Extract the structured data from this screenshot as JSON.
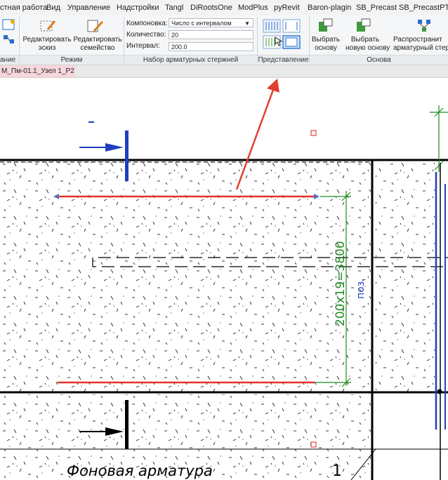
{
  "menu": [
    "стная работа",
    "Вид",
    "Управление",
    "Надстройки",
    "Tangl",
    "DiRootsOne",
    "ModPlus",
    "pyRevit",
    "Baron-plagin",
    "SB_Precast",
    "SB_PrecastPTM"
  ],
  "ribbon": {
    "left_cut_label": "ание",
    "edit_sketch": [
      "Редактировать",
      "эскиз"
    ],
    "edit_family": [
      "Редактировать",
      "семейство"
    ],
    "mode_panel": "Режим",
    "layout_label": "Компоновка:",
    "layout_value": "Число с интервалом",
    "quantity_label": "Количество:",
    "quantity_value": "20",
    "spacing_label": "Интервал:",
    "spacing_value": "200.0",
    "rebar_set_panel": "Набор арматурных стержней",
    "view_panel": "Представление",
    "select_base": [
      "Выбрать",
      "основу"
    ],
    "select_new_base": [
      "Выбрать",
      "новую основу"
    ],
    "distribute": [
      "Распространит",
      "арматурный стерж"
    ],
    "base_panel": "Основа"
  },
  "doc_tab": "М_Пм-01.1_Узел 1_Р2",
  "drawing": {
    "dim_text": "200x19=3800",
    "poz_text": "поз.",
    "bottom_label": "Фоновая арматура",
    "view_number": "1"
  },
  "colors": {
    "rebar": "#e8312c",
    "arrow": "#e2402f",
    "dimension": "#1e8a1e",
    "section": "#1f3fc0"
  }
}
